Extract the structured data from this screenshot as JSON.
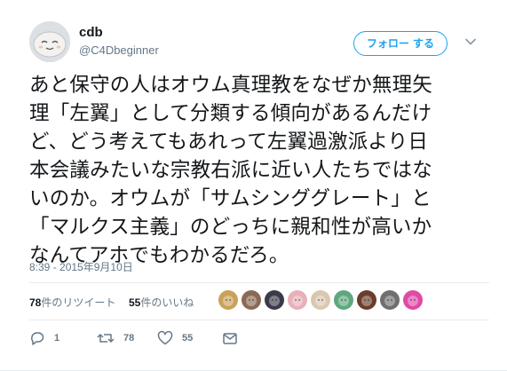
{
  "user": {
    "display_name": "cdb",
    "username": "@C4Dbeginner",
    "avatar_icon": "smiling-face-avatar"
  },
  "follow_button": {
    "label": "フォロー する"
  },
  "tweet": {
    "text": "あと保守の人はオウム真理教をなぜか無理矢\n理「左翼」として分類する傾向があるんだけ\nど、どう考えてもあれって左翼過激派より日\n本会議みたいな宗教右派に近い人たちではな\nいのか。オウムが「サムシンググレート」と\n「マルクス主義」のどっちに親和性が高いか\nなんてアホでもわかるだろ。",
    "timestamp": "8:39 - 2015年9月10日"
  },
  "stats": {
    "retweets_count": "78",
    "retweets_label": "件のリツイート",
    "likes_count": "55",
    "likes_label": "件のいいね"
  },
  "liker_avatars": [
    {
      "icon": "pixel-art-avatar",
      "color": "#c9a25a"
    },
    {
      "icon": "person-photo-avatar",
      "color": "#8a6a55"
    },
    {
      "icon": "dark-character-avatar",
      "color": "#3a3a4a"
    },
    {
      "icon": "girl-anime-avatar",
      "color": "#e8b0b8"
    },
    {
      "icon": "glasses-character-avatar",
      "color": "#d9c7b0"
    },
    {
      "icon": "green-initial-avatar",
      "color": "#5fa87e"
    },
    {
      "icon": "witch-avatar",
      "color": "#6b3d2a"
    },
    {
      "icon": "gray-figure-avatar",
      "color": "#6f6f6f"
    },
    {
      "icon": "pink-blob-avatar",
      "color": "#e04aa6"
    }
  ],
  "actions": {
    "reply_count": "1",
    "retweet_count": "78",
    "like_count": "55"
  },
  "colors": {
    "accent": "#1da1f2",
    "muted": "#657786",
    "text": "#14171a",
    "divider": "#e6ecf0"
  }
}
